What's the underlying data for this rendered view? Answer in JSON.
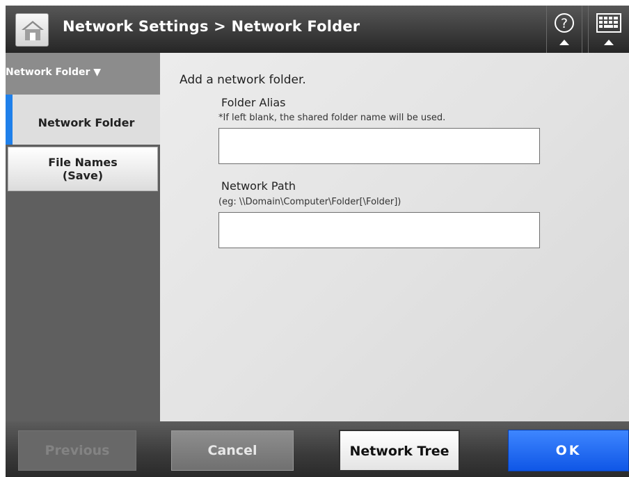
{
  "header": {
    "title": "Network Settings > Network Folder",
    "home_icon": "home-icon",
    "help_icon": "help-icon",
    "keyboard_icon": "keyboard-icon"
  },
  "sidebar": {
    "header_label": "Network Folder ▼",
    "items": [
      {
        "label": "Network Folder",
        "selected": true
      },
      {
        "label": "File Names\n(Save)",
        "selected": false
      }
    ]
  },
  "main": {
    "instruction": "Add a network folder.",
    "folder_alias": {
      "label": "Folder Alias",
      "hint": "*If left blank, the shared folder name will be used.",
      "value": ""
    },
    "network_path": {
      "label": "Network Path",
      "hint": "(eg: \\\\Domain\\Computer\\Folder[\\Folder])",
      "value": ""
    }
  },
  "footer": {
    "previous_label": "Previous",
    "cancel_label": "Cancel",
    "network_tree_label": "Network Tree",
    "ok_label": "OK"
  },
  "colors": {
    "accent": "#1f80ea",
    "ok_button": "#1a5ff0"
  }
}
